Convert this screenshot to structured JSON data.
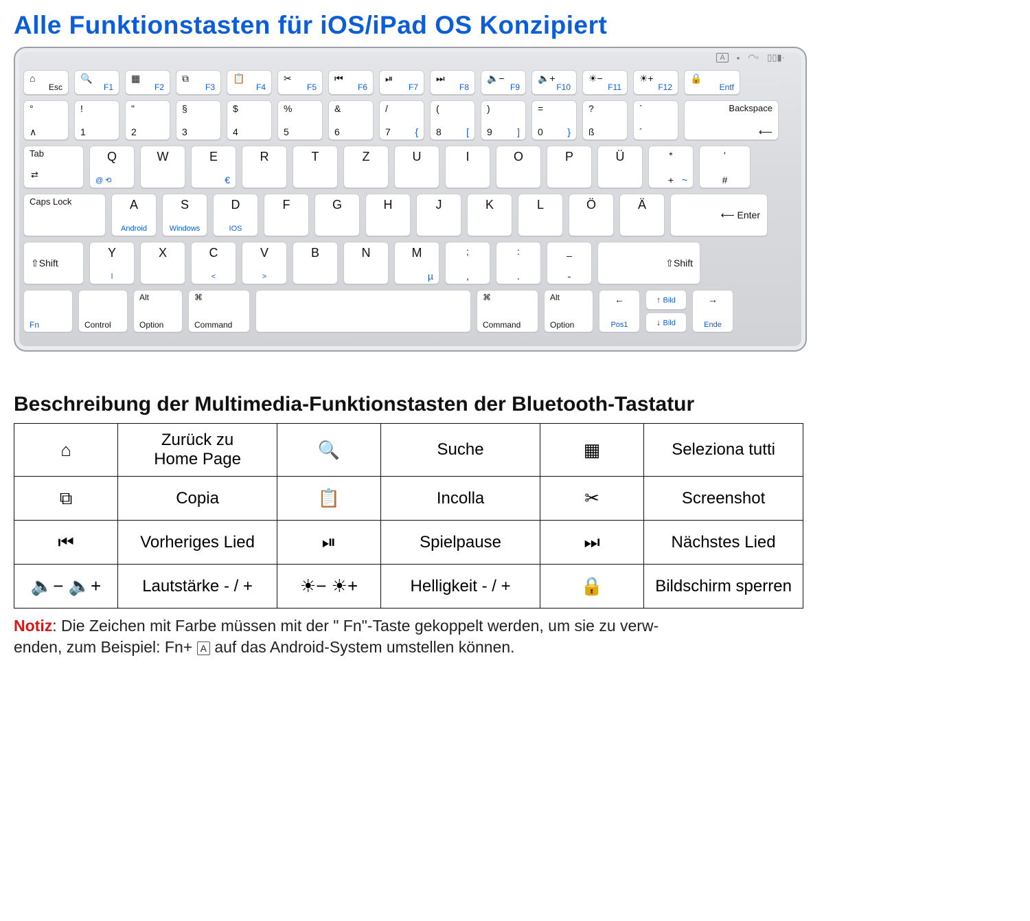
{
  "title": "Alle Funktionstasten für iOS/iPad OS Konzipiert",
  "status": {
    "caps": "A",
    "dot": "•",
    "wifi": "⊻",
    "bat": "▮▯▯"
  },
  "fn_row": [
    {
      "icon": "⌂",
      "label": "Esc"
    },
    {
      "icon": "🔍",
      "label": "F1"
    },
    {
      "icon": "▦",
      "label": "F2"
    },
    {
      "icon": "⧉",
      "label": "F3"
    },
    {
      "icon": "📋",
      "label": "F4"
    },
    {
      "icon": "✂",
      "label": "F5"
    },
    {
      "icon": "⏮",
      "label": "F6"
    },
    {
      "icon": "⏯",
      "label": "F7"
    },
    {
      "icon": "⏭",
      "label": "F8"
    },
    {
      "icon": "🔈−",
      "label": "F9"
    },
    {
      "icon": "🔈+",
      "label": "F10"
    },
    {
      "icon": "☀−",
      "label": "F11"
    },
    {
      "icon": "☀+",
      "label": "F12"
    },
    {
      "icon": "🔒",
      "label": "Entf"
    }
  ],
  "num_row": [
    {
      "tl": "°",
      "bl": "∧"
    },
    {
      "tl": "!",
      "bl": "1"
    },
    {
      "tl": "\"",
      "bl": "2"
    },
    {
      "tl": "§",
      "bl": "3"
    },
    {
      "tl": "$",
      "bl": "4"
    },
    {
      "tl": "%",
      "bl": "5"
    },
    {
      "tl": "&",
      "bl": "6"
    },
    {
      "tl": "/",
      "bl": "7",
      "br": "{"
    },
    {
      "tl": "(",
      "bl": "8",
      "br": "["
    },
    {
      "tl": ")",
      "bl": "9",
      "br": "]"
    },
    {
      "tl": "=",
      "bl": "0",
      "br": "}"
    },
    {
      "tl": "?",
      "bl": "ß"
    },
    {
      "tl": "`",
      "bl": "´"
    }
  ],
  "backspace": "Backspace",
  "tab": "Tab",
  "row_q": [
    {
      "m": "Q",
      "sub": "@",
      "sub2": "⟲"
    },
    {
      "m": "W"
    },
    {
      "m": "E",
      "br": "€"
    },
    {
      "m": "R"
    },
    {
      "m": "T"
    },
    {
      "m": "Z"
    },
    {
      "m": "U"
    },
    {
      "m": "I"
    },
    {
      "m": "O"
    },
    {
      "m": "P"
    },
    {
      "m": "Ü"
    },
    {
      "t": "*",
      "b": "+",
      "br": "~"
    }
  ],
  "hash_key": {
    "t": "'",
    "b": "#"
  },
  "caps": "Caps Lock",
  "row_a": [
    {
      "m": "A",
      "sub": "Android"
    },
    {
      "m": "S",
      "sub": "Windows"
    },
    {
      "m": "D",
      "sub": "IOS"
    },
    {
      "m": "F"
    },
    {
      "m": "G"
    },
    {
      "m": "H"
    },
    {
      "m": "J"
    },
    {
      "m": "K"
    },
    {
      "m": "L"
    },
    {
      "m": "Ö"
    },
    {
      "m": "Ä"
    }
  ],
  "enter": "Enter",
  "shift": "Shift",
  "row_y": [
    {
      "m": "Y",
      "sub": "ǀ"
    },
    {
      "m": "X"
    },
    {
      "m": "C",
      "sub": "<"
    },
    {
      "m": "V",
      "sub": ">"
    },
    {
      "m": "B"
    },
    {
      "m": "N"
    },
    {
      "m": "M",
      "br": "µ"
    },
    {
      "t": ";",
      "b": ","
    },
    {
      "t": ":",
      "b": "."
    },
    {
      "t": "_",
      "b": "-"
    }
  ],
  "bottom": {
    "fn": "Fn",
    "control": "Control",
    "alt": "Alt",
    "option": "Option",
    "cmd": "⌘",
    "command": "Command",
    "pos1": "Pos1",
    "ende": "Ende",
    "bild": "Bild"
  },
  "desc_title": "Beschreibung der Multimedia-Funktionstasten der Bluetooth-Tastatur",
  "desc_rows": [
    [
      {
        "i": "⌂"
      },
      {
        "t": "Zurück zu Home Page"
      },
      {
        "i": "🔍"
      },
      {
        "t": "Suche"
      },
      {
        "i": "▦"
      },
      {
        "t": "Seleziona tutti"
      }
    ],
    [
      {
        "i": "⧉"
      },
      {
        "t": "Copia"
      },
      {
        "i": "📋"
      },
      {
        "t": "Incolla"
      },
      {
        "i": "✂"
      },
      {
        "t": "Screenshot"
      }
    ],
    [
      {
        "i": "⏮"
      },
      {
        "t": "Vorheriges Lied"
      },
      {
        "i": "⏯"
      },
      {
        "t": "Spielpause"
      },
      {
        "i": "⏭"
      },
      {
        "t": "Nächstes Lied"
      }
    ],
    [
      {
        "i": "🔈−   🔈+"
      },
      {
        "t": "Lautstärke - / +"
      },
      {
        "i": "☀−   ☀+"
      },
      {
        "t": "Helligkeit - / +"
      },
      {
        "i": "🔒",
        "lock": true
      },
      {
        "t": "Bildschirm sperren"
      }
    ]
  ],
  "note": {
    "label": "Notiz",
    "text1": ": Die Zeichen mit Farbe müssen mit der \" Fn\"-Taste gekoppelt werden, um sie zu verw-",
    "text2": "enden, zum Beispiel: Fn+ ",
    "chip": "A",
    "text3": " auf das Android-System umstellen können."
  }
}
